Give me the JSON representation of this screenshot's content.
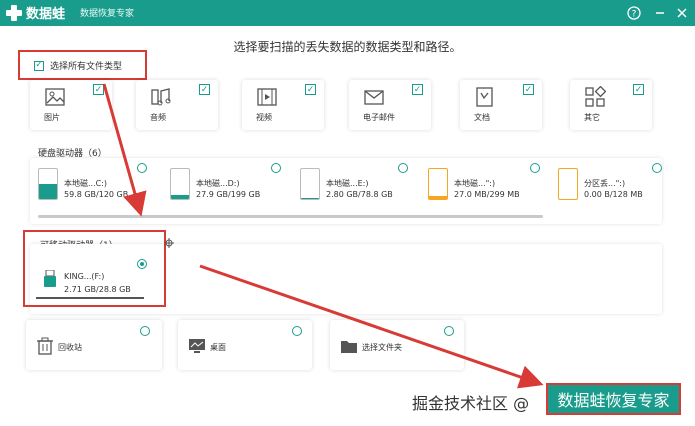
{
  "titlebar": {
    "app_name": "数据蛙",
    "subtitle": "数据恢复专家",
    "help_icon": "help-circle-icon",
    "minimize_icon": "minimize-icon",
    "close_icon": "close-icon",
    "bg_color": "#1a9c8c"
  },
  "prompt": "选择要扫描的丢失数据的数据类型和路径。",
  "select_all": {
    "label": "选择所有文件类型",
    "checked": true
  },
  "file_types": [
    {
      "label": "图片",
      "icon": "image-icon",
      "checked": true
    },
    {
      "label": "音频",
      "icon": "music-icon",
      "checked": true
    },
    {
      "label": "视频",
      "icon": "video-icon",
      "checked": true
    },
    {
      "label": "电子邮件",
      "icon": "email-icon",
      "checked": true
    },
    {
      "label": "文档",
      "icon": "document-icon",
      "checked": true
    },
    {
      "label": "其它",
      "icon": "other-icon",
      "checked": true
    }
  ],
  "hard_drives": {
    "title": "硬盘驱动器（6）",
    "items": [
      {
        "name": "本地磁...C:)",
        "size": "59.8 GB/120 GB",
        "usage": 0.5,
        "color": "#1a9c8c"
      },
      {
        "name": "本地磁...D:)",
        "size": "27.9 GB/199 GB",
        "usage": 0.14,
        "color": "#1a9c8c"
      },
      {
        "name": "本地磁...E:)",
        "size": "2.80 GB/78.8 GB",
        "usage": 0.04,
        "color": "#1a9c8c"
      },
      {
        "name": "本地磁...\":)",
        "size": "27.0 MB/299 MB",
        "usage": 0.09,
        "color": "#f5a623"
      },
      {
        "name": "分区丢...\":)",
        "size": "0.00  B/128 MB",
        "usage": 0.0,
        "color": "#f5a623"
      }
    ]
  },
  "removable": {
    "title": "可移动驱动器（1）",
    "items": [
      {
        "name": "KING...(F:)",
        "size": "2.71 GB/28.8 GB",
        "selected": true
      }
    ]
  },
  "locations": [
    {
      "label": "回收站",
      "icon": "recycle-bin-icon"
    },
    {
      "label": "桌面",
      "icon": "desktop-icon"
    },
    {
      "label": "选择文件夹",
      "icon": "folder-icon"
    }
  ],
  "watermark": "掘金技术社区 @",
  "brand_badge": "数据蛙恢复专家",
  "colors": {
    "accent": "#1a9c8c",
    "highlight": "#d83a36",
    "warning": "#f5a623"
  }
}
